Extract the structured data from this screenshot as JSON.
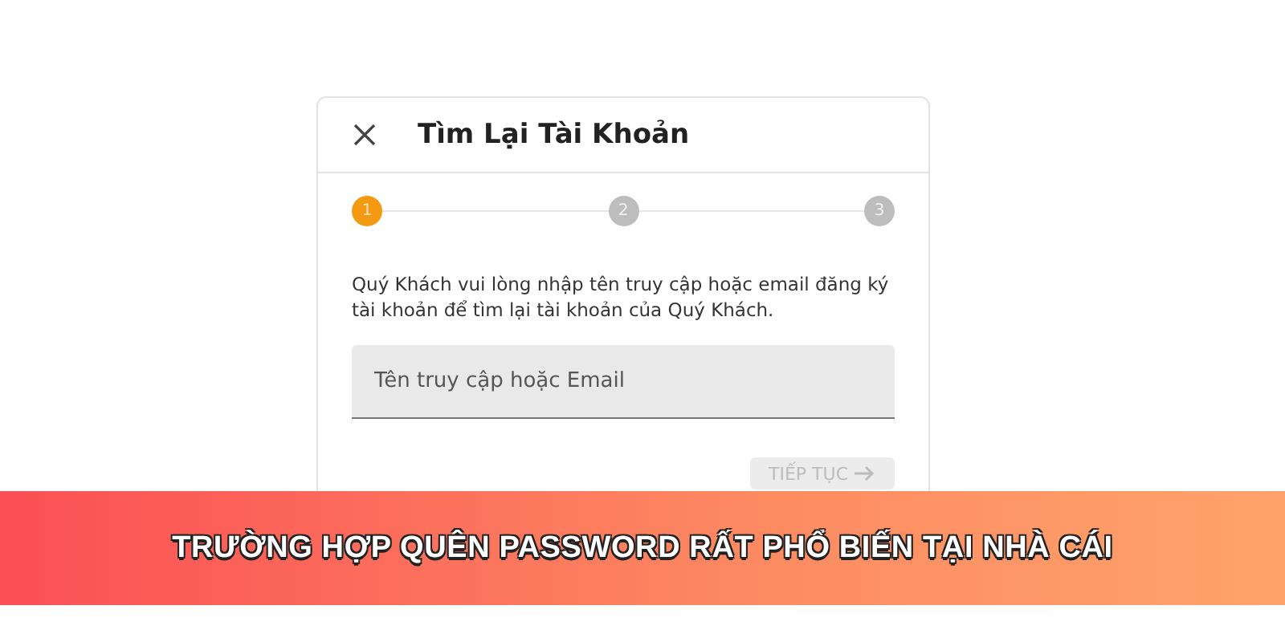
{
  "dialog": {
    "title": "Tìm Lại Tài Khoản",
    "steps": [
      {
        "label": "1",
        "selected": true
      },
      {
        "label": "2",
        "selected": false
      },
      {
        "label": "3",
        "selected": false
      }
    ],
    "instruction": "Quý Khách vui lòng nhập tên truy cập hoặc email đăng ký tài khoản để tìm lại tài khoản của Quý Khách.",
    "field": {
      "placeholder": "Tên truy cập hoặc Email"
    },
    "button": {
      "label": "TIẾP TỤC",
      "disabled": true
    }
  },
  "banner": {
    "text": "TRƯỜNG HỢP QUÊN PASSWORD RẤT PHỔ BIẾN TẠI NHÀ CÁI"
  }
}
